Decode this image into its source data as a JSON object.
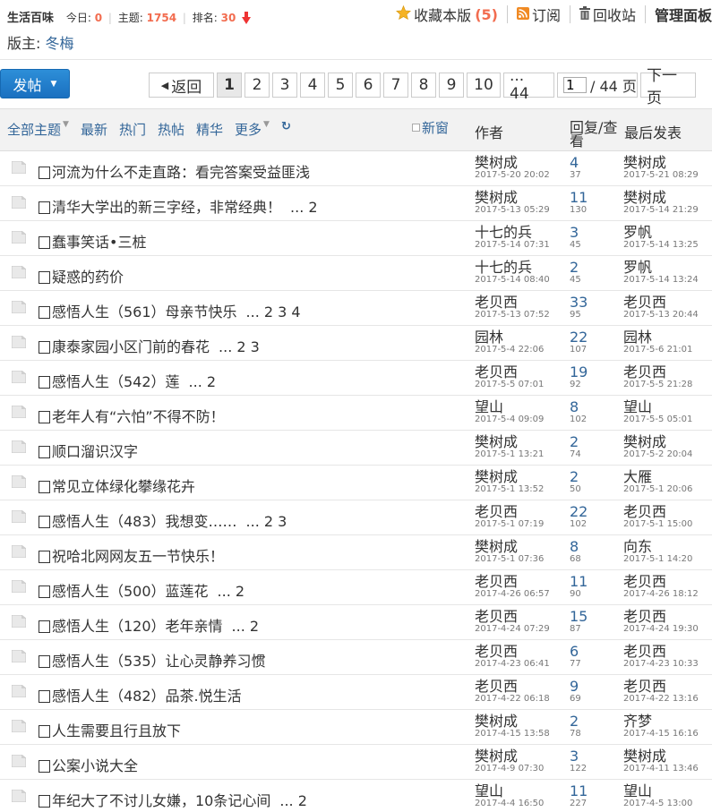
{
  "forum": {
    "name": "生活百味",
    "today_label": "今日:",
    "today": "0",
    "topics_label": "主题:",
    "topics": "1754",
    "rank_label": "排名:",
    "rank": "30",
    "moderator_label": "版主:",
    "moderator": "冬梅"
  },
  "actions": {
    "favorite_label": "收藏本版",
    "favorite_count": "(5)",
    "subscribe_label": "订阅",
    "recycle_label": "回收站",
    "manage_label": "管理面板"
  },
  "toolbar": {
    "post_label": "发帖",
    "back_label": "返回",
    "pages": [
      "1",
      "2",
      "3",
      "4",
      "5",
      "6",
      "7",
      "8",
      "9",
      "10"
    ],
    "last_page_link": "... 44",
    "jump_value": "1",
    "total_pages": "/ 44 页",
    "next_label": "下一页"
  },
  "list_header": {
    "filters": [
      "全部主题",
      "最新",
      "热门",
      "热帖",
      "精华",
      "更多"
    ],
    "new_window": "新窗",
    "author": "作者",
    "reply_view": "回复/查看",
    "last_post": "最后发表"
  },
  "threads": [
    {
      "title": "河流为什么不走直路：看完答案受益匪浅",
      "pages": "",
      "author": "樊树成",
      "date": "2017-5-20 20:02",
      "replies": "4",
      "views": "37",
      "last_user": "樊树成",
      "last_date": "2017-5-21 08:29"
    },
    {
      "title": "清华大学出的新三字经，非常经典！",
      "pages": "... 2",
      "author": "樊树成",
      "date": "2017-5-13 05:29",
      "replies": "11",
      "views": "130",
      "last_user": "樊树成",
      "last_date": "2017-5-14 21:29"
    },
    {
      "title": "蠢事笑话•三桩",
      "pages": "",
      "author": "十七的兵",
      "date": "2017-5-14 07:31",
      "replies": "3",
      "views": "45",
      "last_user": "罗帆",
      "last_date": "2017-5-14 13:25"
    },
    {
      "title": "疑惑的药价",
      "pages": "",
      "author": "十七的兵",
      "date": "2017-5-14 08:40",
      "replies": "2",
      "views": "45",
      "last_user": "罗帆",
      "last_date": "2017-5-14 13:24"
    },
    {
      "title": "感悟人生（561）母亲节快乐",
      "pages": "... 2 3 4",
      "author": "老贝西",
      "date": "2017-5-13 07:52",
      "replies": "33",
      "views": "95",
      "last_user": "老贝西",
      "last_date": "2017-5-13 20:44"
    },
    {
      "title": "康泰家园小区门前的春花",
      "pages": "... 2 3",
      "author": "园林",
      "date": "2017-5-4 22:06",
      "replies": "22",
      "views": "107",
      "last_user": "园林",
      "last_date": "2017-5-6 21:01"
    },
    {
      "title": "感悟人生（542）莲",
      "pages": "... 2",
      "author": "老贝西",
      "date": "2017-5-5 07:01",
      "replies": "19",
      "views": "92",
      "last_user": "老贝西",
      "last_date": "2017-5-5 21:28"
    },
    {
      "title": "老年人有“六怕”不得不防！",
      "pages": "",
      "author": "望山",
      "date": "2017-5-4 09:09",
      "replies": "8",
      "views": "102",
      "last_user": "望山",
      "last_date": "2017-5-5 05:01"
    },
    {
      "title": "顺口溜识汉字",
      "pages": "",
      "author": "樊树成",
      "date": "2017-5-1 13:21",
      "replies": "2",
      "views": "74",
      "last_user": "樊树成",
      "last_date": "2017-5-2 20:04"
    },
    {
      "title": "常见立体绿化攀缘花卉",
      "pages": "",
      "author": "樊树成",
      "date": "2017-5-1 13:52",
      "replies": "2",
      "views": "50",
      "last_user": "大雁",
      "last_date": "2017-5-1 20:06"
    },
    {
      "title": "感悟人生（483）我想变……",
      "pages": "... 2 3",
      "author": "老贝西",
      "date": "2017-5-1 07:19",
      "replies": "22",
      "views": "102",
      "last_user": "老贝西",
      "last_date": "2017-5-1 15:00"
    },
    {
      "title": "祝哈北网网友五一节快乐！",
      "pages": "",
      "author": "樊树成",
      "date": "2017-5-1 07:36",
      "replies": "8",
      "views": "68",
      "last_user": "向东",
      "last_date": "2017-5-1 14:20"
    },
    {
      "title": "感悟人生（500）蓝莲花",
      "pages": "... 2",
      "author": "老贝西",
      "date": "2017-4-26 06:57",
      "replies": "11",
      "views": "90",
      "last_user": "老贝西",
      "last_date": "2017-4-26 18:12"
    },
    {
      "title": "感悟人生（120）老年亲情",
      "pages": "... 2",
      "author": "老贝西",
      "date": "2017-4-24 07:29",
      "replies": "15",
      "views": "87",
      "last_user": "老贝西",
      "last_date": "2017-4-24 19:30"
    },
    {
      "title": "感悟人生（535）让心灵静养习惯",
      "pages": "",
      "author": "老贝西",
      "date": "2017-4-23 06:41",
      "replies": "6",
      "views": "77",
      "last_user": "老贝西",
      "last_date": "2017-4-23 10:33"
    },
    {
      "title": "感悟人生（482）品茶.悦生活",
      "pages": "",
      "author": "老贝西",
      "date": "2017-4-22 06:18",
      "replies": "9",
      "views": "69",
      "last_user": "老贝西",
      "last_date": "2017-4-22 13:16"
    },
    {
      "title": "人生需要且行且放下",
      "pages": "",
      "author": "樊树成",
      "date": "2017-4-15 13:58",
      "replies": "2",
      "views": "78",
      "last_user": "齐梦",
      "last_date": "2017-4-15 16:16"
    },
    {
      "title": "公案小说大全",
      "pages": "",
      "author": "樊树成",
      "date": "2017-4-9 07:30",
      "replies": "3",
      "views": "122",
      "last_user": "樊树成",
      "last_date": "2017-4-11 13:46"
    },
    {
      "title": "年纪大了不讨儿女嫌，10条记心间",
      "pages": "... 2",
      "author": "望山",
      "date": "2017-4-4 16:50",
      "replies": "11",
      "views": "227",
      "last_user": "望山",
      "last_date": "2017-4-5 13:00"
    }
  ]
}
